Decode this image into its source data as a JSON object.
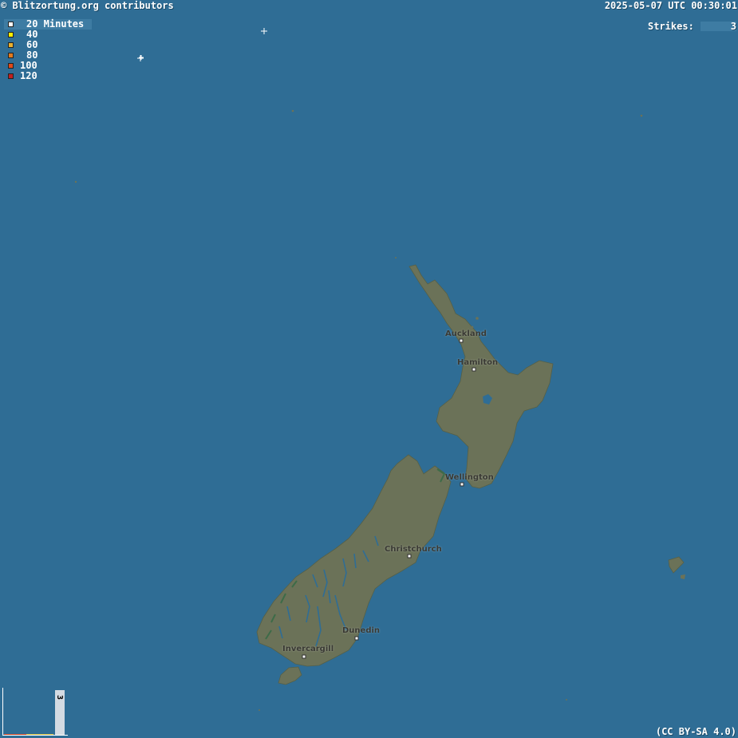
{
  "header": {
    "credit": "© Blitzortung.org contributors",
    "timestamp": "2025-05-07 UTC 00:30:01"
  },
  "legend": {
    "items": [
      {
        "label": "20 Minutes",
        "color": "#ffffff"
      },
      {
        "label": "40",
        "color": "#ffee00"
      },
      {
        "label": "60",
        "color": "#e8b030"
      },
      {
        "label": "80",
        "color": "#e07a20"
      },
      {
        "label": "100",
        "color": "#e04a1a"
      },
      {
        "label": "120",
        "color": "#c02020"
      }
    ]
  },
  "strikes": {
    "label": "Strikes:",
    "count": "3"
  },
  "cities": [
    {
      "name": "Auckland"
    },
    {
      "name": "Hamilton"
    },
    {
      "name": "Wellington"
    },
    {
      "name": "Christchurch"
    },
    {
      "name": "Dunedin"
    },
    {
      "name": "Invercargill"
    }
  ],
  "histogram": {
    "value": "3"
  },
  "license": "(CC BY-SA 4.0)",
  "colors": {
    "ocean": "#2f6d95",
    "land": "#6b7258",
    "river": "#2f6d95"
  }
}
